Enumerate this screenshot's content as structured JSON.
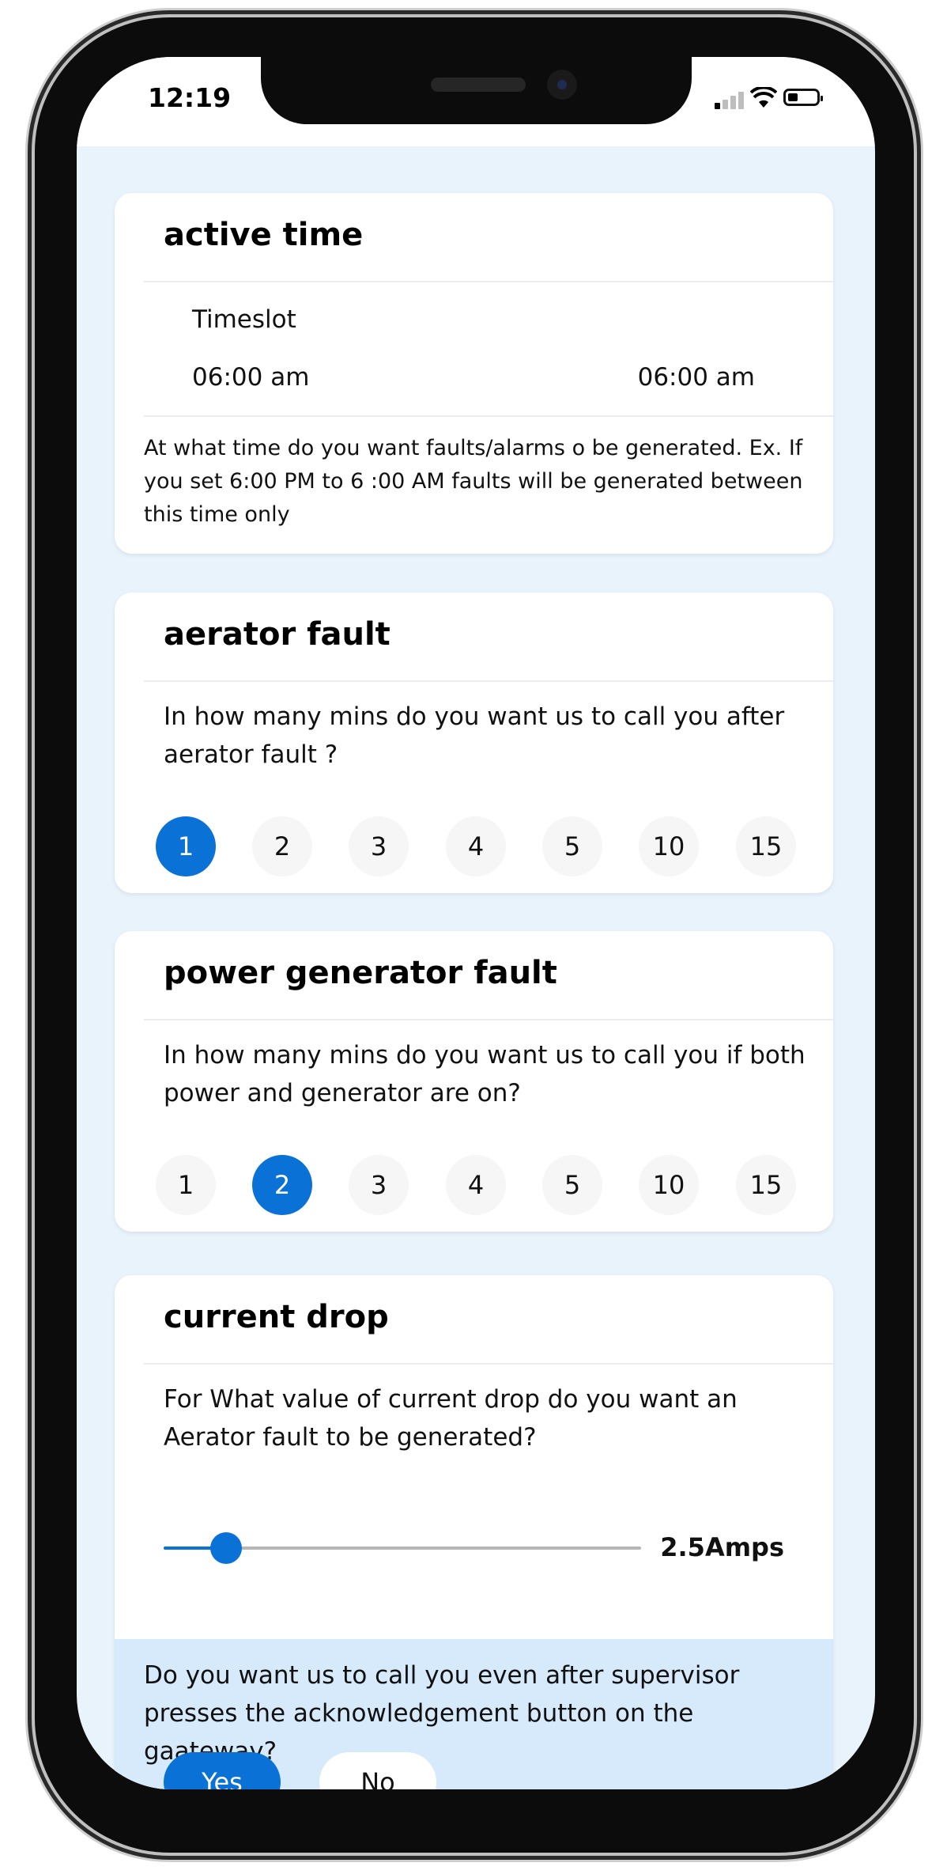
{
  "status_bar": {
    "time": "12:19"
  },
  "colors": {
    "accent": "#0a72d6",
    "background": "#e9f3fc",
    "ack_background": "#d6eafb"
  },
  "active_time": {
    "title": "active time",
    "timeslot_label": "Timeslot",
    "start_time": "06:00 am",
    "end_time": "06:00 am",
    "note": "At what time do you want faults/alarms o be generated. Ex. If you set 6:00 PM to 6 :00 AM faults will be generated  between this time only"
  },
  "aerator_fault": {
    "title": "aerator fault",
    "question": "In how many mins do you want us to call you after aerator fault ?",
    "options": [
      "1",
      "2",
      "3",
      "4",
      "5",
      "10",
      "15"
    ],
    "selected": "1"
  },
  "power_generator_fault": {
    "title": "power generator fault",
    "question": "In how many mins do you want us to call you if both power and generator are on?",
    "options": [
      "1",
      "2",
      "3",
      "4",
      "5",
      "10",
      "15"
    ],
    "selected": "2"
  },
  "current_drop": {
    "title": "current drop",
    "question": "For What value of current drop do you want an Aerator fault to be generated?",
    "slider_fraction": 0.13,
    "value_label": "2.5Amps",
    "ack_question": "Do you want us to call you even after supervisor presses the acknowledgement button on the gaateway?",
    "yes_label": "Yes",
    "no_label": "No",
    "ack_selected": "Yes"
  }
}
